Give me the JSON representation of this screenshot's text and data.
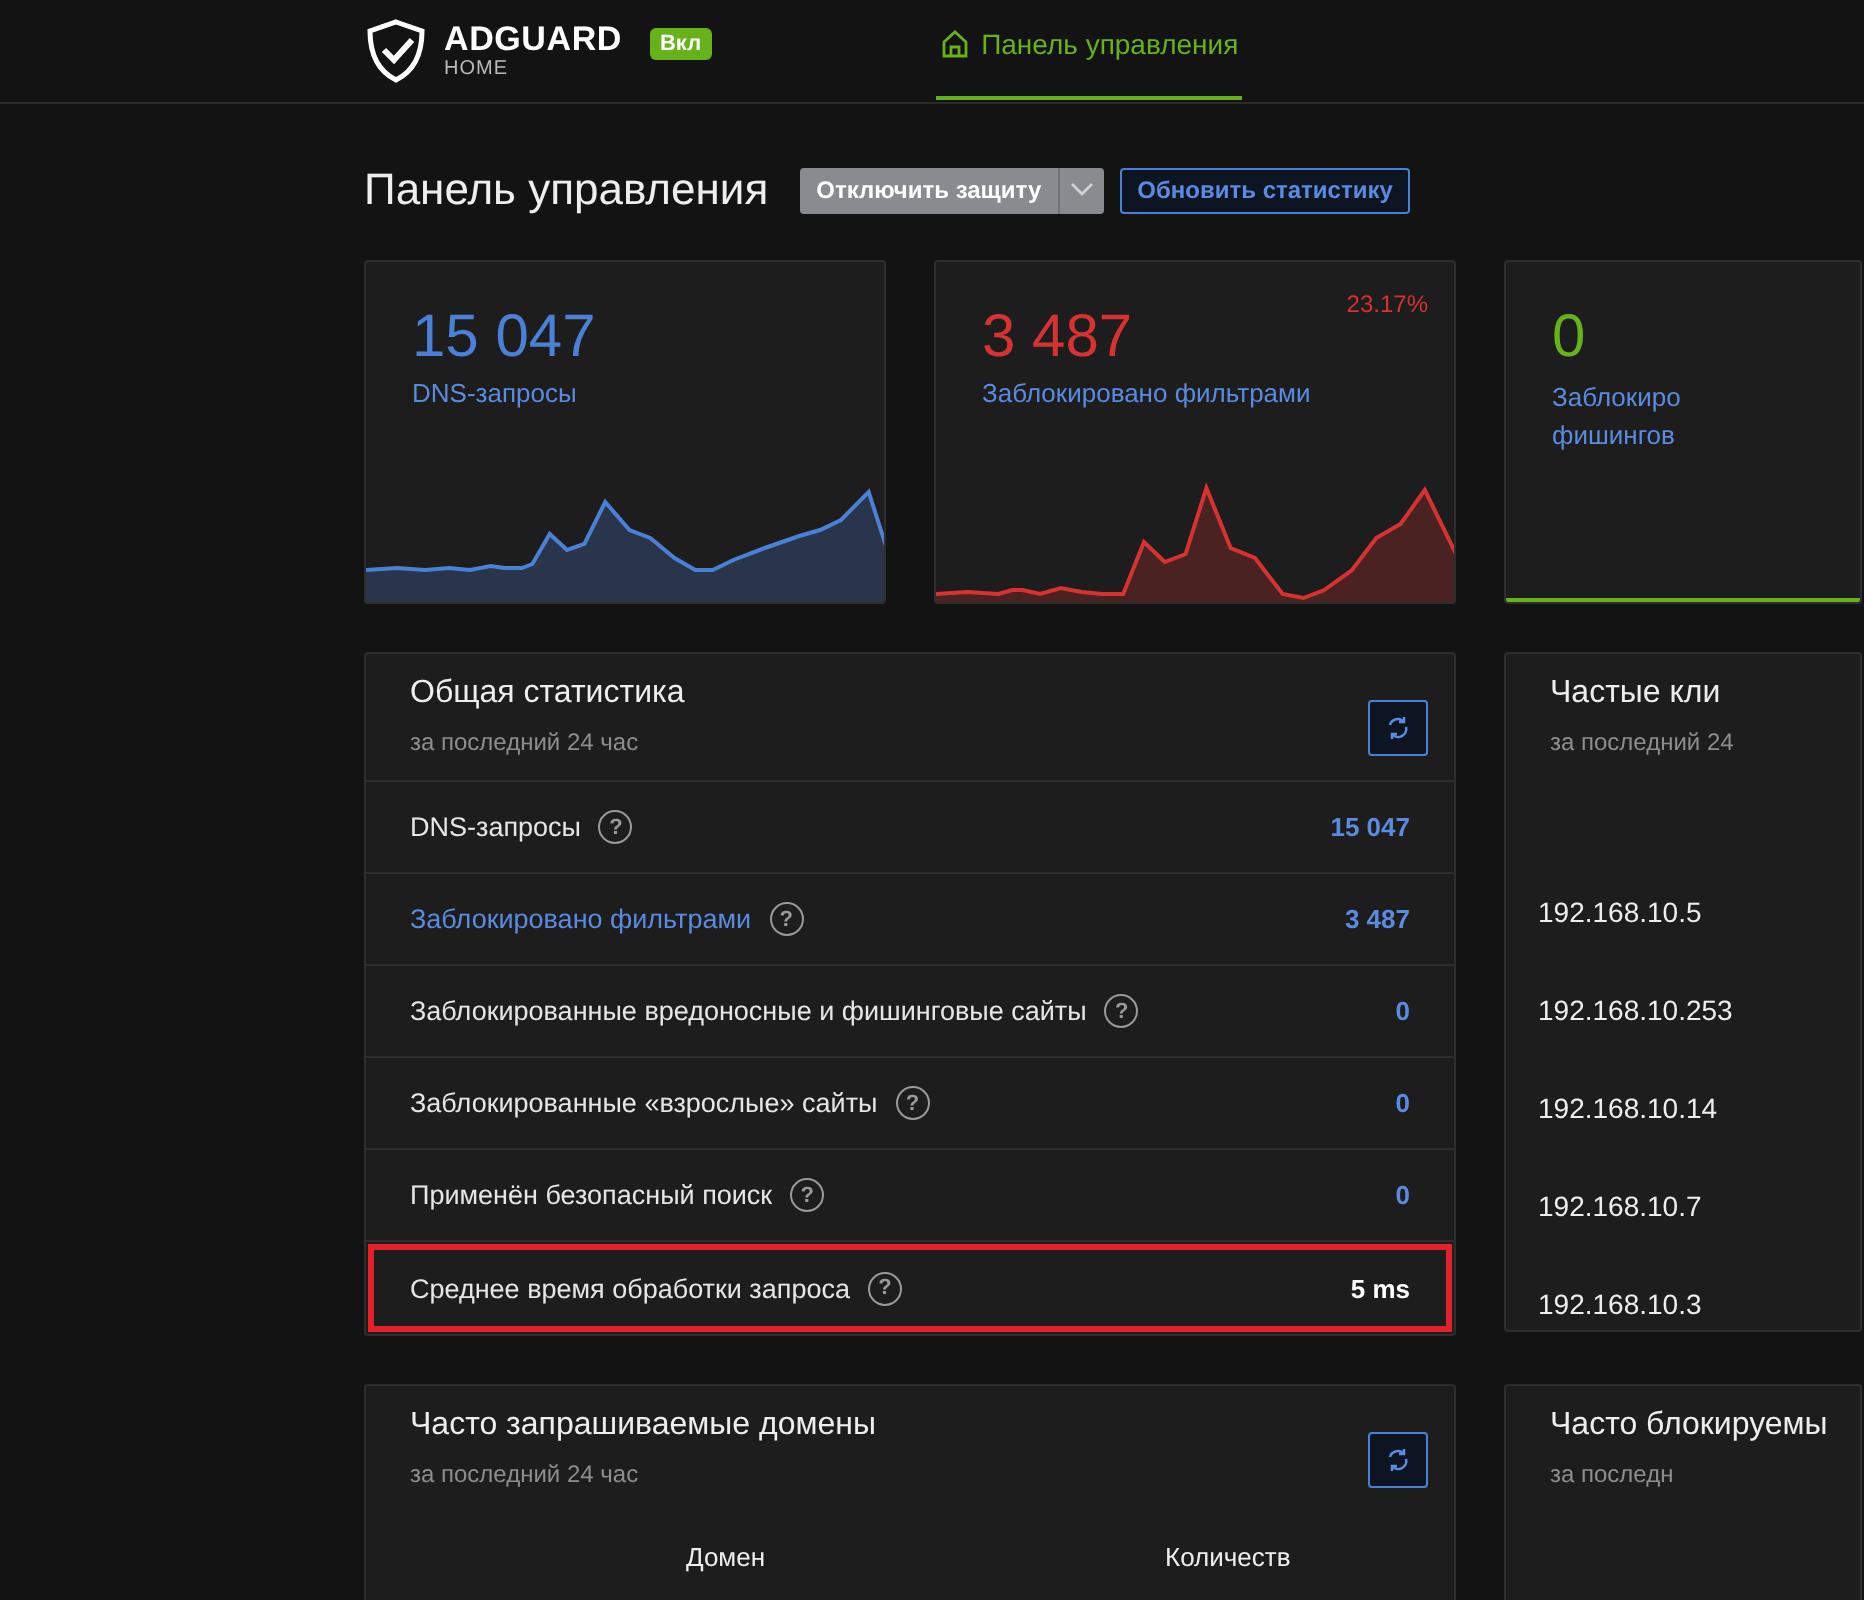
{
  "header": {
    "logo": {
      "name": "ADGUARD",
      "sub": "HOME",
      "badge": "Вкл"
    },
    "nav": [
      {
        "label": "Панель управления",
        "selected": true
      }
    ]
  },
  "page": {
    "title": "Панель управления",
    "buttons": [
      {
        "kind": "split",
        "label": "Отключить защиту"
      },
      {
        "kind": "outline",
        "label": "Обновить статистику"
      }
    ]
  },
  "stat_cards": [
    {
      "kind": "sparkline",
      "value": "15 047",
      "label": "DNS-запросы",
      "color": "#4a80d6"
    },
    {
      "kind": "sparkline",
      "value": "3 487",
      "label": "Заблокировано фильтрами",
      "percent": "23.17%",
      "color": "#d63232"
    },
    {
      "kind": "flat",
      "value": "0",
      "label": "Заблокиро фишингов",
      "color": "#67b21b"
    }
  ],
  "general_stats": {
    "title": "Общая статистика",
    "subtitle": "за последний 24 час",
    "rows": [
      {
        "label": "DNS-запросы",
        "help": "?",
        "value": "15 047",
        "link": false,
        "highlighted": false
      },
      {
        "label": "Заблокировано фильтрами",
        "help": "?",
        "value": "3 487",
        "link": true,
        "highlighted": false
      },
      {
        "label": "Заблокированные вредоносные и фишинговые сайты",
        "help": "?",
        "value": "0",
        "link": false,
        "highlighted": false
      },
      {
        "label": "Заблокированные «взрослые» сайты",
        "help": "?",
        "value": "0",
        "link": false,
        "highlighted": false
      },
      {
        "label": "Применён безопасный поиск",
        "help": "?",
        "value": "0",
        "link": false,
        "highlighted": false
      },
      {
        "label": "Среднее время обработки запроса",
        "help": "?",
        "value": "5 ms",
        "link": false,
        "highlighted": true
      }
    ]
  },
  "top_clients": {
    "title": "Частые кли",
    "subtitle": "за последний 24",
    "rows": [
      "192.168.10.5",
      "192.168.10.253",
      "192.168.10.14",
      "192.168.10.7",
      "192.168.10.3"
    ]
  },
  "top_domains": {
    "title": "Часто запрашиваемые домены",
    "subtitle": "за последний 24 час",
    "columns": [
      "Домен",
      "Количеств"
    ]
  },
  "top_blocked": {
    "title": "Часто блокируемы",
    "subtitle": "за последн"
  }
}
